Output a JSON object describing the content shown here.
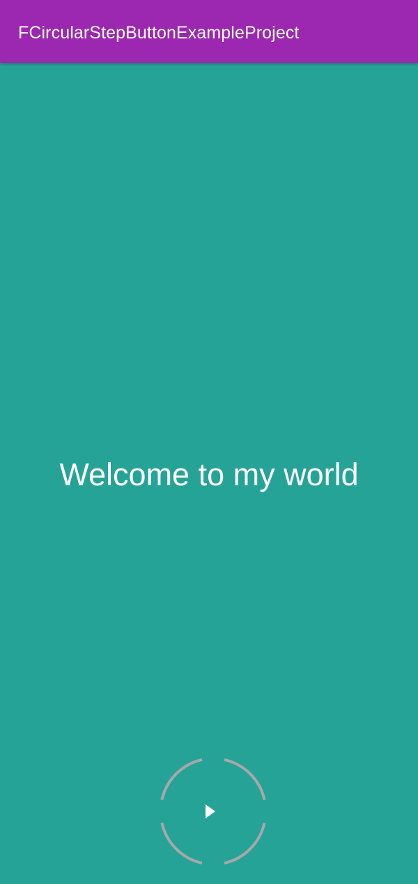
{
  "app_bar": {
    "title": "FCircularStepButtonExampleProject",
    "color": "#9C27B0"
  },
  "content": {
    "welcome_text": "Welcome to my world",
    "background_color": "#26A397"
  },
  "step_button": {
    "icon": "play-icon",
    "ring_color": "#A8A8A8",
    "segments": 4,
    "progress": 0
  }
}
